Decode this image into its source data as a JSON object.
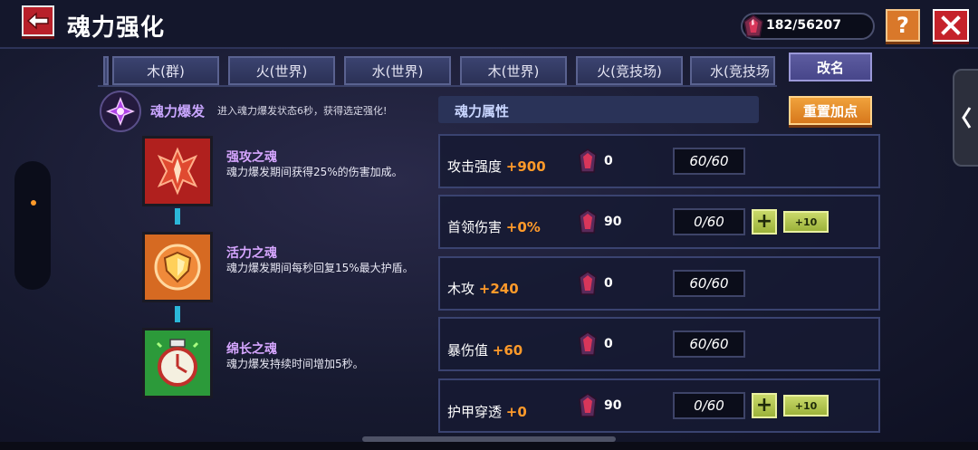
{
  "header": {
    "title": "魂力强化",
    "currency": "182/56207",
    "help_label": "?"
  },
  "tabs": [
    {
      "label": "木(群)"
    },
    {
      "label": "火(世界)"
    },
    {
      "label": "水(世界)"
    },
    {
      "label": "木(世界)"
    },
    {
      "label": "火(竞技场)"
    },
    {
      "label": "水(竞技场"
    }
  ],
  "rename_label": "改名",
  "burst": {
    "title": "魂力爆发",
    "desc": "进入魂力爆发状态6秒，获得选定强化!"
  },
  "souls": [
    {
      "name": "强攻之魂",
      "desc": "魂力爆发期间获得25%的伤害加成。",
      "icon": "attack-soul-icon",
      "color": "#b0201e"
    },
    {
      "name": "活力之魂",
      "desc": "魂力爆发期间每秒回复15%最大护盾。",
      "icon": "shield-soul-icon",
      "color": "#d66a22"
    },
    {
      "name": "绵长之魂",
      "desc": "魂力爆发持续时间增加5秒。",
      "icon": "clock-soul-icon",
      "color": "#2c9a3a"
    }
  ],
  "attributes": {
    "header": "魂力属性",
    "reset_label": "重置加点",
    "rows": [
      {
        "label": "攻击强度",
        "bonus": "+900",
        "cost": "0",
        "level": "60/60",
        "upgradable": false
      },
      {
        "label": "首领伤害",
        "bonus": "+0%",
        "cost": "90",
        "level": "0/60",
        "upgradable": true,
        "plus10": "+10"
      },
      {
        "label": "木攻",
        "bonus": "+240",
        "cost": "0",
        "level": "60/60",
        "upgradable": false
      },
      {
        "label": "暴伤值",
        "bonus": "+60",
        "cost": "0",
        "level": "60/60",
        "upgradable": false
      },
      {
        "label": "护甲穿透",
        "bonus": "+0",
        "cost": "90",
        "level": "0/60",
        "upgradable": true,
        "plus10": "+10"
      }
    ]
  },
  "colors": {
    "accent_orange": "#ff9a2a",
    "soul_name": "#d6a6ff",
    "close_red": "#c5222a",
    "help_orange": "#d9782a"
  }
}
